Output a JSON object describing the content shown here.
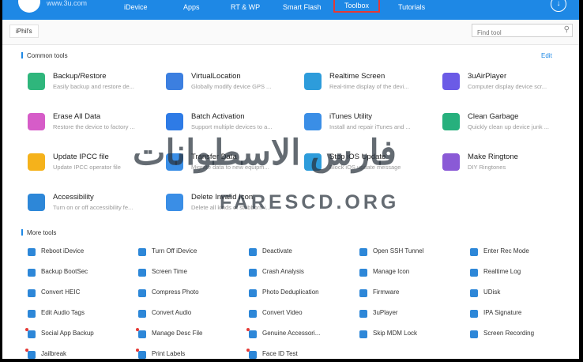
{
  "header": {
    "site": "www.3u.com",
    "nav": [
      "iDevice",
      "Apps",
      "RT & WP",
      "Smart Flash",
      "Toolbox",
      "Tutorials"
    ],
    "active_nav": "Toolbox"
  },
  "subbar": {
    "tab": "iPhil's",
    "search_placeholder": "Find tool"
  },
  "common": {
    "title": "Common tools",
    "edit": "Edit",
    "tools": [
      {
        "name": "Backup/Restore",
        "desc": "Easily backup and restore de...",
        "color": "#2fb67c"
      },
      {
        "name": "VirtualLocation",
        "desc": "Globally modify device GPS ...",
        "color": "#3c7fe0"
      },
      {
        "name": "Realtime Screen",
        "desc": "Real-time display of the devi...",
        "color": "#2d9cdb"
      },
      {
        "name": "3uAirPlayer",
        "desc": "Computer display device scr...",
        "color": "#6b5be6"
      },
      {
        "name": "Erase All Data",
        "desc": "Restore the device to factory ...",
        "color": "#d65cc8"
      },
      {
        "name": "Batch Activation",
        "desc": "Support multiple devices to a...",
        "color": "#2e7be6"
      },
      {
        "name": "iTunes Utility",
        "desc": "Install and repair iTunes and ...",
        "color": "#3a8ee6"
      },
      {
        "name": "Clean Garbage",
        "desc": "Quickly clean up device junk ...",
        "color": "#27b07d"
      },
      {
        "name": "Update IPCC file",
        "desc": "Update IPCC operator file",
        "color": "#f5b21b"
      },
      {
        "name": "Transfer Data",
        "desc": "Migrate data to new equipm...",
        "color": "#3a8ee6"
      },
      {
        "name": "Stop iOS Update",
        "desc": "Block iOS update message",
        "color": "#2d9cdb"
      },
      {
        "name": "Make Ringtone",
        "desc": "DIY Ringtones",
        "color": "#8a5ad6"
      },
      {
        "name": "Accessibility",
        "desc": "Turn on or off accessibility fe...",
        "color": "#2d87d8"
      },
      {
        "name": "Delete Invalid Icon",
        "desc": "Delete all kinds of stubborn i...",
        "color": "#3a8ee6"
      }
    ]
  },
  "more": {
    "title": "More tools",
    "tools": [
      "Reboot iDevice",
      "Turn Off iDevice",
      "Deactivate",
      "Open SSH Tunnel",
      "Enter Rec Mode",
      "Backup BootSec",
      "Screen Time",
      "Crash Analysis",
      "Manage Icon",
      "Realtime Log",
      "Convert HEIC",
      "Compress Photo",
      "Photo Deduplication",
      "Firmware",
      "UDisk",
      "Edit Audio Tags",
      "Convert Audio",
      "Convert Video",
      "3uPlayer",
      "IPA Signature",
      "Social App Backup",
      "Manage Desc File",
      "Genuine Accessori...",
      "Skip MDM Lock",
      "Screen Recording",
      "Jailbreak",
      "Print Labels",
      "Face ID Test"
    ],
    "dotted": [
      "Social App Backup",
      "Manage Desc File",
      "Genuine Accessori...",
      "Jailbreak",
      "Print Labels",
      "Face ID Test"
    ]
  },
  "watermark": {
    "arabic": "فارس الاسطوانات",
    "url": "FARESCD.ORG"
  }
}
